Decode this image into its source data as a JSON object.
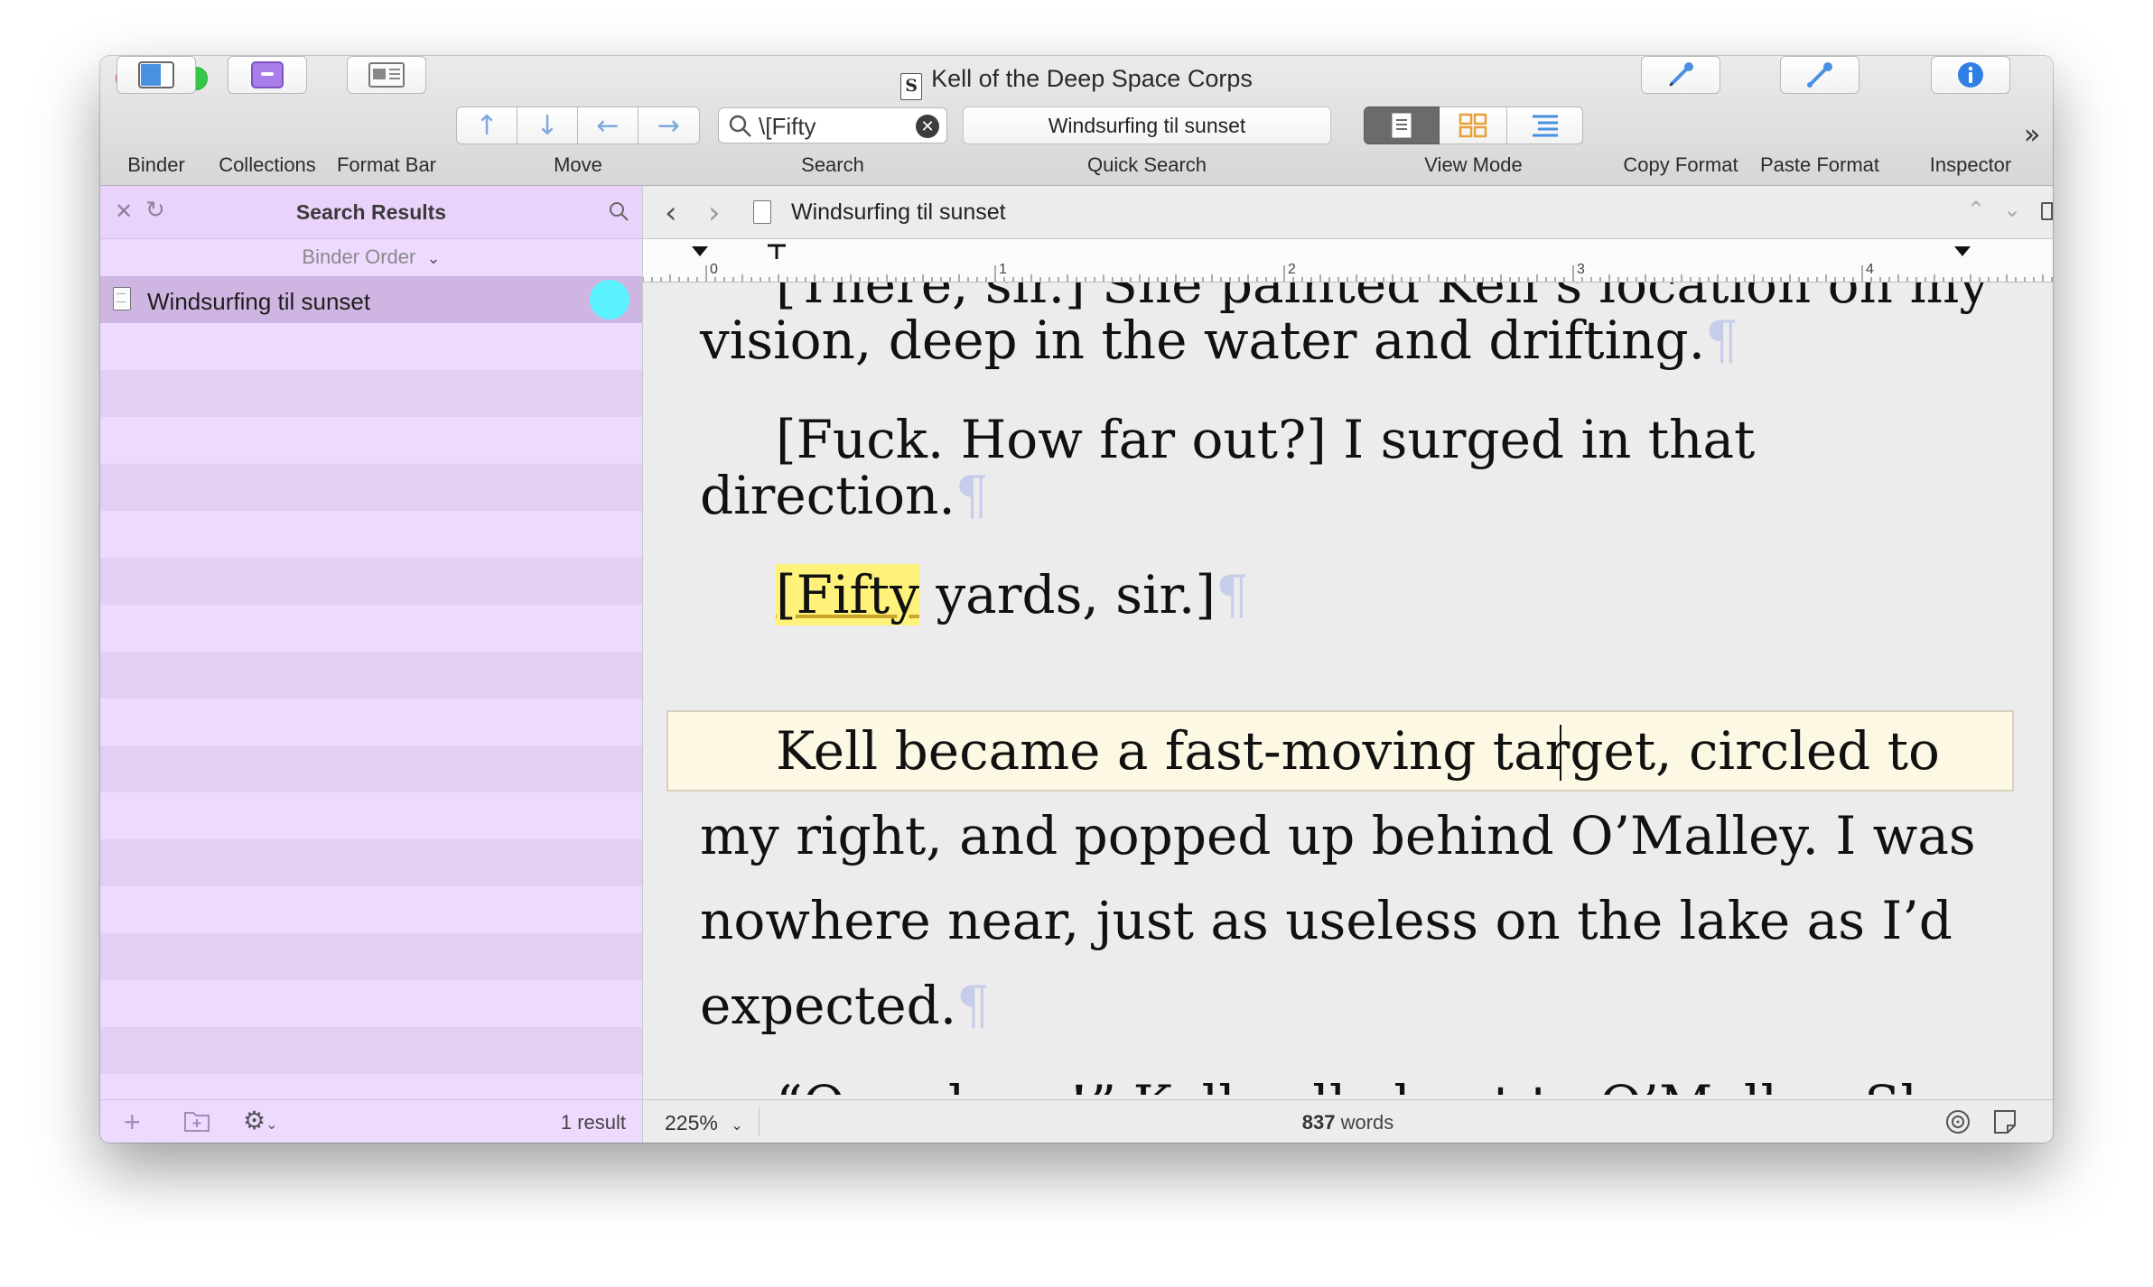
{
  "window": {
    "title": "Kell of the Deep Space Corps",
    "doc_glyph": "S"
  },
  "toolbar": {
    "binder": "Binder",
    "collections": "Collections",
    "format_bar": "Format Bar",
    "move": "Move",
    "search": "Search",
    "search_value": "\\[Fifty",
    "quick_search_label": "Quick Search",
    "quick_search_value": "Windsurfing til sunset",
    "view_mode": "View Mode",
    "copy_format": "Copy Format",
    "paste_format": "Paste Format",
    "inspector": "Inspector",
    "overflow": "»",
    "move_arrows": [
      "↑",
      "↓",
      "←",
      "→"
    ]
  },
  "sidebar": {
    "title": "Search Results",
    "sort": "Binder Order",
    "results": [
      {
        "label": "Windsurfing til sunset",
        "label_color": "#5af2ff"
      }
    ],
    "result_count": "1 result"
  },
  "editor": {
    "doc_title": "Windsurfing til sunset",
    "ruler_marks": [
      "0",
      "1",
      "2",
      "3",
      "4"
    ],
    "paragraphs": {
      "p0_line1": "[There, sir.] She painted Kell’s location on my",
      "p0_line2": "vision, deep in the water and drifting.",
      "p1_line1": "[Fuck. How far out?] I surged in that",
      "p1_line2": "direction.",
      "p2_match": "[Fifty",
      "p2_rest": " yards, sir.]",
      "p3_line1": "Kell became a fast-moving target, circled to",
      "p3_line2": "my right, and popped up behind O’Malley. I was",
      "p3_line3": "nowhere near, just as useless on the lake as I’d",
      "p3_line4": "expected.",
      "p4_line1": "“Over here!” Kell yelled out to O’Malley. She"
    },
    "pilcrow": "¶",
    "zoom": "225%",
    "word_count_number": "837",
    "word_count_label": " words"
  },
  "colors": {
    "sidebar_bg": "#eed9ff",
    "selected_row": "#cfb5e2",
    "search_highlight": "#fff27a",
    "current_line": "#fdf8e4",
    "toolbar_arrow": "#7ea8e0"
  }
}
